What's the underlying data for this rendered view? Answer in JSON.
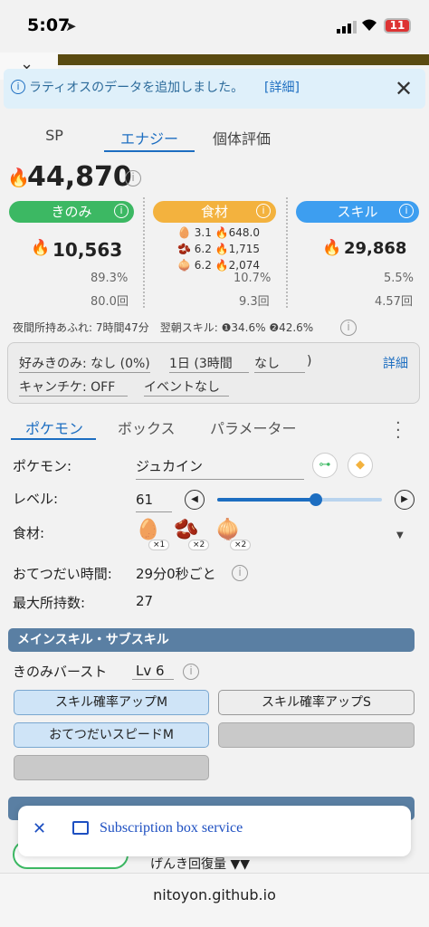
{
  "status": {
    "time": "5:07",
    "battery": "11"
  },
  "notice": {
    "text": "ラティオスのデータを追加しました。",
    "link": "[詳細]"
  },
  "tabs": [
    "SP",
    "エナジー",
    "個体評価"
  ],
  "energy": {
    "total": "44,870"
  },
  "cats": {
    "berry": {
      "label": "きのみ",
      "value": "10,563",
      "pct": "89.3%",
      "count": "80.0回"
    },
    "ingredient": {
      "label": "食材",
      "pct": "10.7%",
      "count": "9.3回",
      "rows": [
        {
          "qty": "3.1",
          "energy": "648.0"
        },
        {
          "qty": "6.2",
          "energy": "1,715"
        },
        {
          "qty": "6.2",
          "energy": "2,074"
        }
      ]
    },
    "skill": {
      "label": "スキル",
      "value": "29,868",
      "pct": "5.5%",
      "count": "4.57回"
    }
  },
  "info": "夜間所持あふれ: 7時間47分　翌朝スキル: ❶34.6% ❷42.6%",
  "settings": {
    "fav_label": "好みきのみ: なし (0%)",
    "period": "1日 (3時間",
    "period2": "なし",
    "paren": ")",
    "detail": "詳細",
    "candy": "キャンチケ: OFF",
    "event": "イベントなし"
  },
  "sectabs": [
    "ポケモン",
    "ボックス",
    "パラメーター"
  ],
  "form": {
    "pokemon_label": "ポケモン:",
    "pokemon": "ジュカイン",
    "level_label": "レベル:",
    "level": "61",
    "ingredients_label": "食材:",
    "ing_mult": [
      "×1",
      "×2",
      "×2"
    ],
    "help_label": "おてつだい時間:",
    "help": "29分0秒ごと",
    "carry_label": "最大所持数:",
    "carry": "27"
  },
  "skills": {
    "header": "メインスキル・サブスキル",
    "main": "きのみバースト",
    "main_lv": "Lv 6",
    "subs": [
      "スキル確率アップM",
      "スキル確率アップS",
      "おてつだいスピードM"
    ]
  },
  "footer": {
    "partial": "げんき回復量 ▼▼",
    "subscription": "Subscription box service",
    "url": "nitoyon.github.io"
  },
  "colors": {
    "berry": "#3cb863",
    "ingredient": "#f3b23e",
    "skill": "#3d9ef0",
    "accent": "#1d6ec1"
  }
}
